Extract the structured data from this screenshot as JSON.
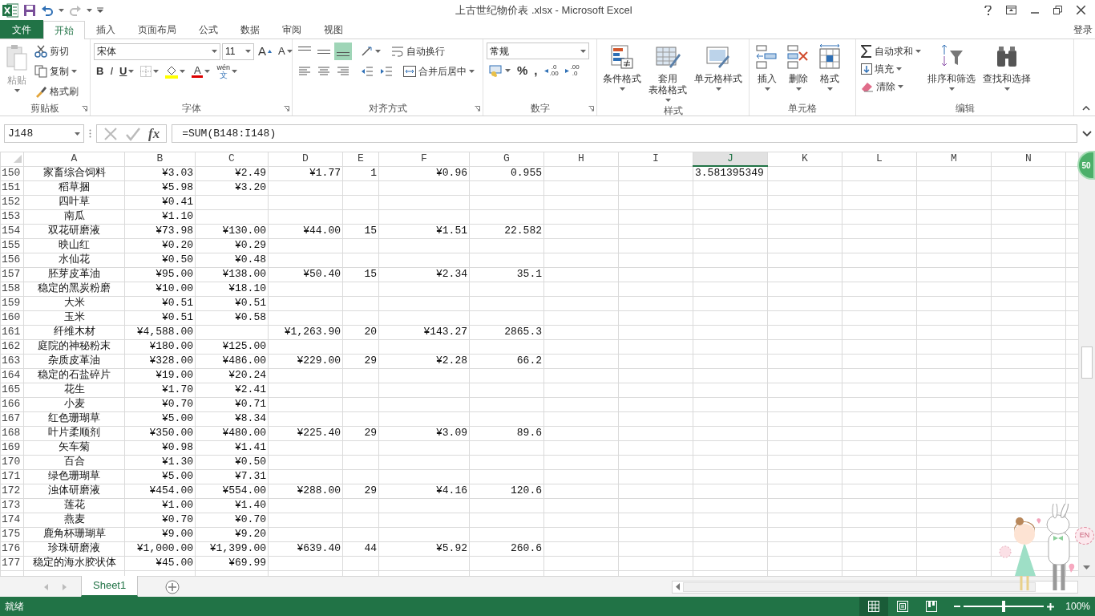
{
  "window": {
    "title": "上古世纪物价表 .xlsx - Microsoft Excel",
    "sign_in": "登录"
  },
  "ribbon_tabs": [
    {
      "label": "文件",
      "kind": "file",
      "selected": false
    },
    {
      "label": "开始",
      "kind": "tab",
      "selected": true
    },
    {
      "label": "插入",
      "kind": "tab",
      "selected": false
    },
    {
      "label": "页面布局",
      "kind": "tab",
      "selected": false
    },
    {
      "label": "公式",
      "kind": "tab",
      "selected": false
    },
    {
      "label": "数据",
      "kind": "tab",
      "selected": false
    },
    {
      "label": "审阅",
      "kind": "tab",
      "selected": false
    },
    {
      "label": "视图",
      "kind": "tab",
      "selected": false
    }
  ],
  "clipboard": {
    "label": "剪贴板",
    "paste": "粘贴",
    "paste_disabled": true,
    "cut": "剪切",
    "copy": "复制",
    "format_painter": "格式刷"
  },
  "font": {
    "label": "字体",
    "font_name": "宋体",
    "font_size": "11",
    "grow_font": "A",
    "shrink_font": "A",
    "bold": "B",
    "italic": "I",
    "underline": "U",
    "font_color": "A",
    "phonetic_top": "wén",
    "phonetic_bottom": "文"
  },
  "alignment": {
    "label": "对齐方式",
    "vertical_align": [
      {
        "selected": false
      },
      {
        "selected": false
      },
      {
        "selected": true
      }
    ],
    "wrap_text": "自动换行",
    "merge_center": "合并后居中"
  },
  "number": {
    "label": "数字",
    "format": "常规",
    "percent": "%",
    "comma": ",",
    "increase_decimal": [
      ".0",
      ".00"
    ],
    "decrease_decimal": [
      ".00",
      ".0"
    ]
  },
  "styles": {
    "label": "样式",
    "conditional_format": "条件格式",
    "table_format": [
      "套用",
      "表格格式"
    ],
    "cell_styles": "单元格样式"
  },
  "cells": {
    "label": "单元格",
    "insert": "插入",
    "delete": "删除",
    "format": "格式"
  },
  "editing": {
    "label": "编辑",
    "autosum": "自动求和",
    "fill": "填充",
    "clear": "清除",
    "sort_filter": "排序和筛选",
    "find_select": "查找和选择"
  },
  "formula_bar": {
    "name_box": "J148",
    "fx": "fx",
    "formula": "=SUM(B148:I148)"
  },
  "columns": [
    {
      "label": "A",
      "selected": false
    },
    {
      "label": "B",
      "selected": false
    },
    {
      "label": "C",
      "selected": false
    },
    {
      "label": "D",
      "selected": false
    },
    {
      "label": "E",
      "selected": false
    },
    {
      "label": "F",
      "selected": false
    },
    {
      "label": "G",
      "selected": false
    },
    {
      "label": "H",
      "selected": false
    },
    {
      "label": "I",
      "selected": false
    },
    {
      "label": "J",
      "selected": true
    },
    {
      "label": "K",
      "selected": false
    },
    {
      "label": "L",
      "selected": false
    },
    {
      "label": "M",
      "selected": false
    },
    {
      "label": "N",
      "selected": false
    }
  ],
  "rows": [
    {
      "number": "150",
      "cells": {
        "A": "家畜综合饲料",
        "B": "¥3.03",
        "C": "¥2.49",
        "D": "¥1.77",
        "E": "1",
        "F": "¥0.96",
        "G": "0.955",
        "J": "3.581395349"
      }
    },
    {
      "number": "151",
      "cells": {
        "A": "稻草捆",
        "B": "¥5.98",
        "C": "¥3.20"
      }
    },
    {
      "number": "152",
      "cells": {
        "A": "四叶草",
        "B": "¥0.41"
      }
    },
    {
      "number": "153",
      "cells": {
        "A": "南瓜",
        "B": "¥1.10"
      }
    },
    {
      "number": "154",
      "cells": {
        "A": "双花研磨液",
        "B": "¥73.98",
        "C": "¥130.00",
        "D": "¥44.00",
        "E": "15",
        "F": "¥1.51",
        "G": "22.582"
      }
    },
    {
      "number": "155",
      "cells": {
        "A": "映山红",
        "B": "¥0.20",
        "C": "¥0.29"
      }
    },
    {
      "number": "156",
      "cells": {
        "A": "水仙花",
        "B": "¥0.50",
        "C": "¥0.48"
      }
    },
    {
      "number": "157",
      "cells": {
        "A": "胚芽皮革油",
        "B": "¥95.00",
        "C": "¥138.00",
        "D": "¥50.40",
        "E": "15",
        "F": "¥2.34",
        "G": "35.1"
      }
    },
    {
      "number": "158",
      "cells": {
        "A": "稳定的黑炭粉磨",
        "B": "¥10.00",
        "C": "¥18.10"
      }
    },
    {
      "number": "159",
      "cells": {
        "A": "大米",
        "B": "¥0.51",
        "C": "¥0.51"
      }
    },
    {
      "number": "160",
      "cells": {
        "A": "玉米",
        "B": "¥0.51",
        "C": "¥0.58"
      }
    },
    {
      "number": "161",
      "cells": {
        "A": "纤维木材",
        "B": "¥4,588.00",
        "D": "¥1,263.90",
        "E": "20",
        "F": "¥143.27",
        "G": "2865.3"
      }
    },
    {
      "number": "162",
      "cells": {
        "A": "庭院的神秘粉末",
        "B": "¥180.00",
        "C": "¥125.00"
      }
    },
    {
      "number": "163",
      "cells": {
        "A": "杂质皮革油",
        "B": "¥328.00",
        "C": "¥486.00",
        "D": "¥229.00",
        "E": "29",
        "F": "¥2.28",
        "G": "66.2"
      }
    },
    {
      "number": "164",
      "cells": {
        "A": "稳定的石盐碎片",
        "B": "¥19.00",
        "C": "¥20.24"
      }
    },
    {
      "number": "165",
      "cells": {
        "A": "花生",
        "B": "¥1.70",
        "C": "¥2.41"
      }
    },
    {
      "number": "166",
      "cells": {
        "A": "小麦",
        "B": "¥0.70",
        "C": "¥0.71"
      }
    },
    {
      "number": "167",
      "cells": {
        "A": "红色珊瑚草",
        "B": "¥5.00",
        "C": "¥8.34"
      }
    },
    {
      "number": "168",
      "cells": {
        "A": "叶片柔顺剂",
        "B": "¥350.00",
        "C": "¥480.00",
        "D": "¥225.40",
        "E": "29",
        "F": "¥3.09",
        "G": "89.6"
      }
    },
    {
      "number": "169",
      "cells": {
        "A": "矢车菊",
        "B": "¥0.98",
        "C": "¥1.41"
      }
    },
    {
      "number": "170",
      "cells": {
        "A": "百合",
        "B": "¥1.30",
        "C": "¥0.50"
      }
    },
    {
      "number": "171",
      "cells": {
        "A": "绿色珊瑚草",
        "B": "¥5.00",
        "C": "¥7.31"
      }
    },
    {
      "number": "172",
      "cells": {
        "A": "浊体研磨液",
        "B": "¥454.00",
        "C": "¥554.00",
        "D": "¥288.00",
        "E": "29",
        "F": "¥4.16",
        "G": "120.6"
      }
    },
    {
      "number": "173",
      "cells": {
        "A": "莲花",
        "B": "¥1.00",
        "C": "¥1.40"
      }
    },
    {
      "number": "174",
      "cells": {
        "A": "燕麦",
        "B": "¥0.70",
        "C": "¥0.70"
      }
    },
    {
      "number": "175",
      "cells": {
        "A": "鹿角杯珊瑚草",
        "B": "¥9.00",
        "C": "¥9.20"
      }
    },
    {
      "number": "176",
      "cells": {
        "A": "珍珠研磨液",
        "B": "¥1,000.00",
        "C": "¥1,399.00",
        "D": "¥639.40",
        "E": "44",
        "F": "¥5.92",
        "G": "260.6"
      }
    },
    {
      "number": "177",
      "cells": {
        "A": "稳定的海水胶状体",
        "B": "¥45.00",
        "C": "¥69.99"
      }
    }
  ],
  "sheet_tabs": [
    {
      "label": "Sheet1",
      "selected": true
    }
  ],
  "status_bar": {
    "status": "就绪",
    "views": [
      {
        "kind": "normal",
        "selected": true
      },
      {
        "kind": "page_layout",
        "selected": false
      },
      {
        "kind": "page_break",
        "selected": false
      }
    ],
    "zoom_slider": {
      "level": 0.5
    },
    "zoom": "100%"
  },
  "floating_badge": "50",
  "ime_widget": {
    "language": "EN"
  }
}
